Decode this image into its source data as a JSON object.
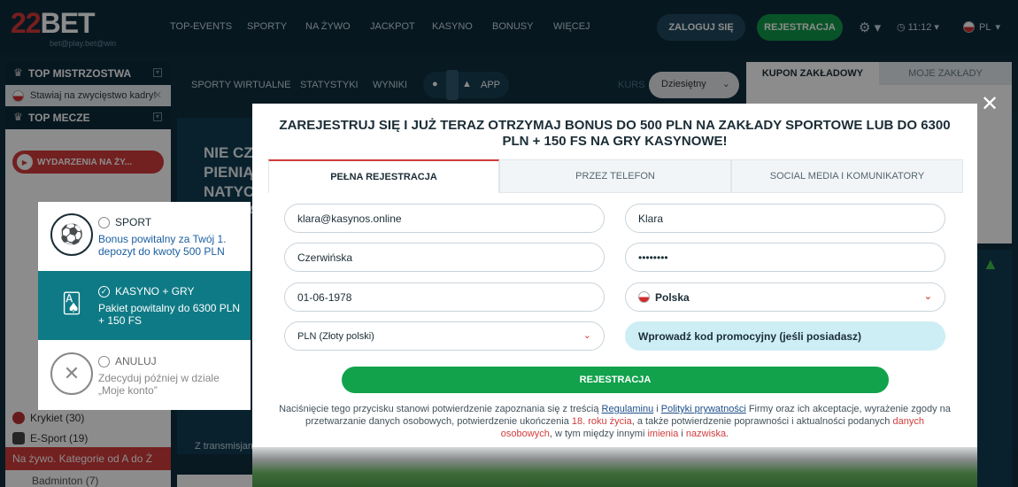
{
  "header": {
    "logo": "22BET",
    "logo_sub": "bet@play.bet@win",
    "nav": [
      "TOP-EVENTS",
      "SPORTY",
      "NA ŻYWO",
      "JACKPOT",
      "KASYNO",
      "BONUSY",
      "WIĘCEJ"
    ],
    "login_label": "ZALOGUJ SIĘ",
    "register_label": "REJESTRACJA",
    "time": "11:12",
    "lang": "PL"
  },
  "sidebar": {
    "top_championships": "TOP MISTRZOSTWA",
    "championship_item": "Stawiaj na zwycięstwo kadry!",
    "top_matches": "TOP MECZE",
    "live_events": "WYDARZENIA NA ŻY...",
    "sports": [
      "Krykiet (30)",
      "E-Sport (19)"
    ],
    "live_categories": "Na żywo. Kategorie od A do Ż",
    "last_item": "Badminton (7)"
  },
  "center": {
    "links": [
      "SPORTY WIRTUALNE",
      "STATYSTYKI",
      "WYNIKI"
    ],
    "app_label": "APP",
    "kurs_label": "KURS",
    "kurs_value": "Dziesiętny",
    "promo": "NIE CZEK\nPIENIĄDZ\nNATYCH\nWYPŁAT",
    "stream_label": "Z transmisjam"
  },
  "right_panel": {
    "tab_coupon": "KUPON ZAKŁADOWY",
    "tab_my_bets": "MOJE ZAKŁADY"
  },
  "modal": {
    "title": "ZAREJESTRUJ SIĘ I JUŻ TERAZ OTRZYMAJ BONUS DO 500 PLN NA ZAKŁADY SPORTOWE LUB DO 6300 PLN + 150 FS NA GRY KASYNOWE!",
    "tabs": [
      "PEŁNA REJESTRACJA",
      "PRZEZ TELEFON",
      "SOCIAL MEDIA I KOMUNIKATORY"
    ],
    "fields": {
      "email": "klara@kasynos.online",
      "first_name": "Klara",
      "last_name": "Czerwińska",
      "password": "••••••••",
      "birthdate": "01-06-1978",
      "country": "Polska",
      "currency": "PLN (Złoty polski)",
      "promo": "Wprowadź kod promocyjny (jeśli posiadasz)"
    },
    "submit_label": "REJESTRACJA",
    "legal": {
      "p1": "Naciśnięcie tego przycisku stanowi potwierdzenie zapoznania się z treścią ",
      "link1": "Regulaminu",
      "p2": " i ",
      "link2": "Polityki prywatności",
      "p3": " Firmy oraz ich akceptacje, wyrażenie zgody na przetwarzanie danych osobowych, potwierdzenie ukończenia ",
      "red1": "18. roku życia",
      "p4": ", a także potwierdzenie poprawności i aktualności podanych ",
      "red2": "danych osobowych",
      "p5": ", w tym między innymi ",
      "red3": "imienia",
      "p6": " i ",
      "red4": "nazwiska",
      "p7": "."
    }
  },
  "bonus": {
    "options": [
      {
        "name": "SPORT",
        "desc": "Bonus powitalny za Twój 1. depozyt do kwoty 500 PLN",
        "icon": "soccer-ball-icon",
        "selected": false
      },
      {
        "name": "KASYNO + GRY",
        "desc": "Pakiet powitalny do 6300 PLN + 150 FS",
        "icon": "cards-dice-icon",
        "selected": true
      },
      {
        "name": "ANULUJ",
        "desc": "Zdecyduj później w dziale „Moje konto”",
        "icon": "close-icon",
        "selected": false
      }
    ]
  }
}
